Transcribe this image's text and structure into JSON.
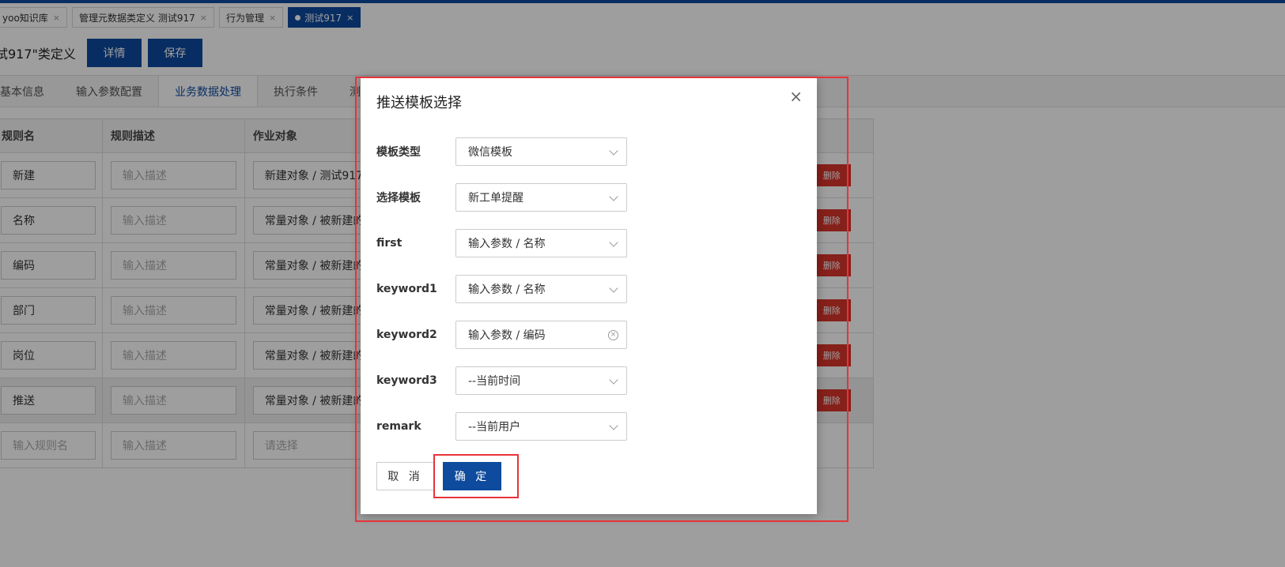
{
  "tabs": [
    {
      "label": "yoo知识库",
      "close": "×"
    },
    {
      "label": "管理元数据类定义 测试917",
      "close": "×"
    },
    {
      "label": "行为管理",
      "close": "×"
    },
    {
      "label": "测试917",
      "close": "×",
      "active": true
    }
  ],
  "header": {
    "title": "试917\"类定义",
    "detail_label": "详情",
    "save_label": "保存"
  },
  "subtabs": [
    "基本信息",
    "输入参数配置",
    "业务数据处理",
    "执行条件",
    "测"
  ],
  "grid": {
    "headers": [
      "规则名",
      "规则描述",
      "作业对象"
    ],
    "rows": [
      {
        "name": "新建",
        "desc": "输入描述",
        "target": "新建对象 / 测试917",
        "delete": "删除"
      },
      {
        "name": "名称",
        "desc": "输入描述",
        "target": "常量对象 / 被新建的",
        "delete": "删除"
      },
      {
        "name": "编码",
        "desc": "输入描述",
        "target": "常量对象 / 被新建的",
        "delete": "删除"
      },
      {
        "name": "部门",
        "desc": "输入描述",
        "target": "常量对象 / 被新建的",
        "delete": "删除"
      },
      {
        "name": "岗位",
        "desc": "输入描述",
        "target": "常量对象 / 被新建的",
        "delete": "删除"
      },
      {
        "name": "推送",
        "desc": "输入描述",
        "target": "常量对象 / 被新建的",
        "delete": "删除"
      }
    ],
    "new_row": {
      "name_placeholder": "输入规则名",
      "desc_placeholder": "输入描述",
      "target_placeholder": "请选择"
    }
  },
  "modal": {
    "title": "推送模板选择",
    "close": "×",
    "fields": [
      {
        "label": "模板类型",
        "value": "微信模板"
      },
      {
        "label": "选择模板",
        "value": "新工单提醒"
      },
      {
        "label": "first",
        "value": "输入参数 / 名称"
      },
      {
        "label": "keyword1",
        "value": "输入参数 / 名称"
      },
      {
        "label": "keyword2",
        "value": "输入参数 / 编码"
      },
      {
        "label": "keyword3",
        "value": "--当前时间"
      },
      {
        "label": "remark",
        "value": "--当前用户"
      }
    ],
    "cancel_label": "取 消",
    "ok_label": "确 定"
  },
  "colors": {
    "primary": "#0e4a9e",
    "danger": "#d9342b",
    "highlight": "#e8333a"
  }
}
